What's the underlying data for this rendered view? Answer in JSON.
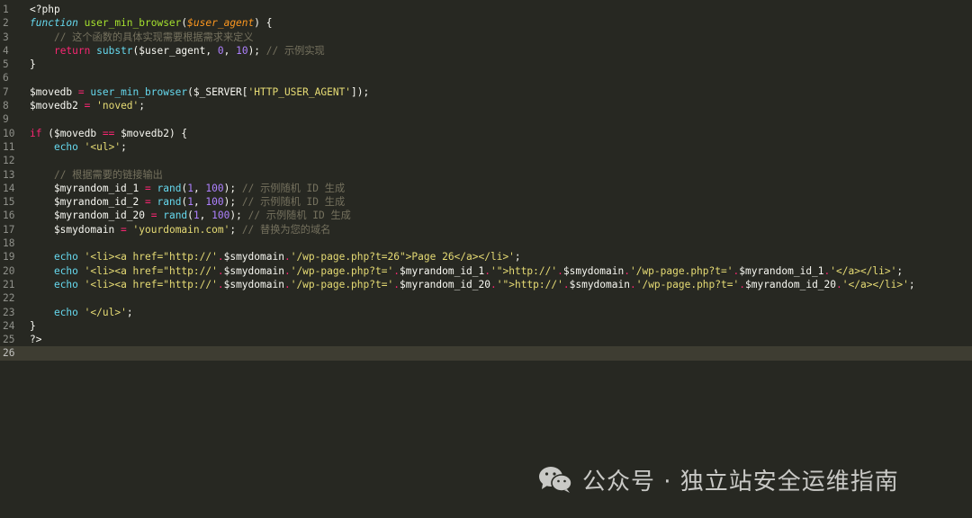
{
  "lines": [
    {
      "n": "1",
      "tokens": [
        {
          "c": "plain",
          "t": "<?php"
        }
      ]
    },
    {
      "n": "2",
      "tokens": [
        {
          "c": "fn",
          "t": "function"
        },
        {
          "c": "plain",
          "t": " "
        },
        {
          "c": "fname",
          "t": "user_min_browser"
        },
        {
          "c": "plain",
          "t": "("
        },
        {
          "c": "param",
          "t": "$user_agent"
        },
        {
          "c": "plain",
          "t": ") {"
        }
      ]
    },
    {
      "n": "3",
      "tokens": [
        {
          "c": "plain",
          "t": "    "
        },
        {
          "c": "cm",
          "t": "// 这个函数的具体实现需要根据需求来定义"
        }
      ]
    },
    {
      "n": "4",
      "tokens": [
        {
          "c": "plain",
          "t": "    "
        },
        {
          "c": "kw",
          "t": "return"
        },
        {
          "c": "plain",
          "t": " "
        },
        {
          "c": "builtin",
          "t": "substr"
        },
        {
          "c": "plain",
          "t": "($user_agent, "
        },
        {
          "c": "num",
          "t": "0"
        },
        {
          "c": "plain",
          "t": ", "
        },
        {
          "c": "num",
          "t": "10"
        },
        {
          "c": "plain",
          "t": "); "
        },
        {
          "c": "cm",
          "t": "// 示例实现"
        }
      ]
    },
    {
      "n": "5",
      "tokens": [
        {
          "c": "plain",
          "t": "}"
        }
      ]
    },
    {
      "n": "6",
      "tokens": []
    },
    {
      "n": "7",
      "tokens": [
        {
          "c": "plain",
          "t": "$movedb "
        },
        {
          "c": "op",
          "t": "="
        },
        {
          "c": "plain",
          "t": " "
        },
        {
          "c": "builtin",
          "t": "user_min_browser"
        },
        {
          "c": "plain",
          "t": "($_SERVER["
        },
        {
          "c": "str",
          "t": "'HTTP_USER_AGENT'"
        },
        {
          "c": "plain",
          "t": "]);"
        }
      ]
    },
    {
      "n": "8",
      "tokens": [
        {
          "c": "plain",
          "t": "$movedb2 "
        },
        {
          "c": "op",
          "t": "="
        },
        {
          "c": "plain",
          "t": " "
        },
        {
          "c": "str",
          "t": "'noved'"
        },
        {
          "c": "plain",
          "t": ";"
        }
      ]
    },
    {
      "n": "9",
      "tokens": []
    },
    {
      "n": "10",
      "tokens": [
        {
          "c": "kw",
          "t": "if"
        },
        {
          "c": "plain",
          "t": " ($movedb "
        },
        {
          "c": "op",
          "t": "=="
        },
        {
          "c": "plain",
          "t": " $movedb2) {"
        }
      ]
    },
    {
      "n": "11",
      "tokens": [
        {
          "c": "plain",
          "t": "    "
        },
        {
          "c": "builtin",
          "t": "echo"
        },
        {
          "c": "plain",
          "t": " "
        },
        {
          "c": "str",
          "t": "'<ul>'"
        },
        {
          "c": "plain",
          "t": ";"
        }
      ]
    },
    {
      "n": "12",
      "tokens": []
    },
    {
      "n": "13",
      "tokens": [
        {
          "c": "plain",
          "t": "    "
        },
        {
          "c": "cm",
          "t": "// 根据需要的链接输出"
        }
      ]
    },
    {
      "n": "14",
      "tokens": [
        {
          "c": "plain",
          "t": "    $myrandom_id_1 "
        },
        {
          "c": "op",
          "t": "="
        },
        {
          "c": "plain",
          "t": " "
        },
        {
          "c": "builtin",
          "t": "rand"
        },
        {
          "c": "plain",
          "t": "("
        },
        {
          "c": "num",
          "t": "1"
        },
        {
          "c": "plain",
          "t": ", "
        },
        {
          "c": "num",
          "t": "100"
        },
        {
          "c": "plain",
          "t": "); "
        },
        {
          "c": "cm",
          "t": "// 示例随机 ID 生成"
        }
      ]
    },
    {
      "n": "15",
      "tokens": [
        {
          "c": "plain",
          "t": "    $myrandom_id_2 "
        },
        {
          "c": "op",
          "t": "="
        },
        {
          "c": "plain",
          "t": " "
        },
        {
          "c": "builtin",
          "t": "rand"
        },
        {
          "c": "plain",
          "t": "("
        },
        {
          "c": "num",
          "t": "1"
        },
        {
          "c": "plain",
          "t": ", "
        },
        {
          "c": "num",
          "t": "100"
        },
        {
          "c": "plain",
          "t": "); "
        },
        {
          "c": "cm",
          "t": "// 示例随机 ID 生成"
        }
      ]
    },
    {
      "n": "16",
      "tokens": [
        {
          "c": "plain",
          "t": "    $myrandom_id_20 "
        },
        {
          "c": "op",
          "t": "="
        },
        {
          "c": "plain",
          "t": " "
        },
        {
          "c": "builtin",
          "t": "rand"
        },
        {
          "c": "plain",
          "t": "("
        },
        {
          "c": "num",
          "t": "1"
        },
        {
          "c": "plain",
          "t": ", "
        },
        {
          "c": "num",
          "t": "100"
        },
        {
          "c": "plain",
          "t": "); "
        },
        {
          "c": "cm",
          "t": "// 示例随机 ID 生成"
        }
      ]
    },
    {
      "n": "17",
      "tokens": [
        {
          "c": "plain",
          "t": "    $smydomain "
        },
        {
          "c": "op",
          "t": "="
        },
        {
          "c": "plain",
          "t": " "
        },
        {
          "c": "str",
          "t": "'yourdomain.com'"
        },
        {
          "c": "plain",
          "t": "; "
        },
        {
          "c": "cm",
          "t": "// 替换为您的域名"
        }
      ]
    },
    {
      "n": "18",
      "tokens": []
    },
    {
      "n": "19",
      "tokens": [
        {
          "c": "plain",
          "t": "    "
        },
        {
          "c": "builtin",
          "t": "echo"
        },
        {
          "c": "plain",
          "t": " "
        },
        {
          "c": "str",
          "t": "'<li><a href=\"http://'"
        },
        {
          "c": "op",
          "t": "."
        },
        {
          "c": "plain",
          "t": "$smydomain"
        },
        {
          "c": "op",
          "t": "."
        },
        {
          "c": "str",
          "t": "'/wp-page.php?t=26\">Page 26</a></li>'"
        },
        {
          "c": "plain",
          "t": ";"
        }
      ]
    },
    {
      "n": "20",
      "tokens": [
        {
          "c": "plain",
          "t": "    "
        },
        {
          "c": "builtin",
          "t": "echo"
        },
        {
          "c": "plain",
          "t": " "
        },
        {
          "c": "str",
          "t": "'<li><a href=\"http://'"
        },
        {
          "c": "op",
          "t": "."
        },
        {
          "c": "plain",
          "t": "$smydomain"
        },
        {
          "c": "op",
          "t": "."
        },
        {
          "c": "str",
          "t": "'/wp-page.php?t='"
        },
        {
          "c": "op",
          "t": "."
        },
        {
          "c": "plain",
          "t": "$myrandom_id_1"
        },
        {
          "c": "op",
          "t": "."
        },
        {
          "c": "str",
          "t": "'\">http://'"
        },
        {
          "c": "op",
          "t": "."
        },
        {
          "c": "plain",
          "t": "$smydomain"
        },
        {
          "c": "op",
          "t": "."
        },
        {
          "c": "str",
          "t": "'/wp-page.php?t='"
        },
        {
          "c": "op",
          "t": "."
        },
        {
          "c": "plain",
          "t": "$myrandom_id_1"
        },
        {
          "c": "op",
          "t": "."
        },
        {
          "c": "str",
          "t": "'</a></li>'"
        },
        {
          "c": "plain",
          "t": ";"
        }
      ]
    },
    {
      "n": "21",
      "tokens": [
        {
          "c": "plain",
          "t": "    "
        },
        {
          "c": "builtin",
          "t": "echo"
        },
        {
          "c": "plain",
          "t": " "
        },
        {
          "c": "str",
          "t": "'<li><a href=\"http://'"
        },
        {
          "c": "op",
          "t": "."
        },
        {
          "c": "plain",
          "t": "$smydomain"
        },
        {
          "c": "op",
          "t": "."
        },
        {
          "c": "str",
          "t": "'/wp-page.php?t='"
        },
        {
          "c": "op",
          "t": "."
        },
        {
          "c": "plain",
          "t": "$myrandom_id_20"
        },
        {
          "c": "op",
          "t": "."
        },
        {
          "c": "str",
          "t": "'\">http://'"
        },
        {
          "c": "op",
          "t": "."
        },
        {
          "c": "plain",
          "t": "$smydomain"
        },
        {
          "c": "op",
          "t": "."
        },
        {
          "c": "str",
          "t": "'/wp-page.php?t='"
        },
        {
          "c": "op",
          "t": "."
        },
        {
          "c": "plain",
          "t": "$myrandom_id_20"
        },
        {
          "c": "op",
          "t": "."
        },
        {
          "c": "str",
          "t": "'</a></li>'"
        },
        {
          "c": "plain",
          "t": ";"
        }
      ]
    },
    {
      "n": "22",
      "tokens": []
    },
    {
      "n": "23",
      "tokens": [
        {
          "c": "plain",
          "t": "    "
        },
        {
          "c": "builtin",
          "t": "echo"
        },
        {
          "c": "plain",
          "t": " "
        },
        {
          "c": "str",
          "t": "'</ul>'"
        },
        {
          "c": "plain",
          "t": ";"
        }
      ]
    },
    {
      "n": "24",
      "tokens": [
        {
          "c": "plain",
          "t": "}"
        }
      ]
    },
    {
      "n": "25",
      "tokens": [
        {
          "c": "plain",
          "t": "?>"
        }
      ]
    },
    {
      "n": "26",
      "tokens": []
    }
  ],
  "current_line": "26",
  "watermark": {
    "text": "公众号 · 独立站安全运维指南",
    "icon": "wechat-icon"
  },
  "colors": {
    "background": "#272822",
    "keyword": "#f92672",
    "function": "#66d9ef",
    "function_name": "#a6e22e",
    "parameter": "#fd971f",
    "string": "#e6db74",
    "number": "#ae81ff",
    "comment": "#75715e"
  }
}
